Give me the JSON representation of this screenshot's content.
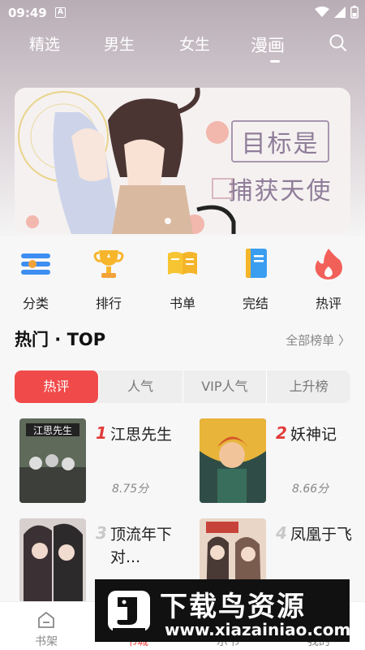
{
  "status_bar": {
    "time": "09:49",
    "notif_letter": "A"
  },
  "nav": {
    "tabs": [
      {
        "label": "精选",
        "active": false
      },
      {
        "label": "男生",
        "active": false
      },
      {
        "label": "女生",
        "active": false
      },
      {
        "label": "漫画",
        "active": true
      }
    ],
    "search_icon": "search-icon"
  },
  "banner": {
    "title_line1": "目标是",
    "title_line2": "捕获天使"
  },
  "categories": [
    {
      "label": "分类",
      "icon": "category-icon",
      "color": "#3d8ef0"
    },
    {
      "label": "排行",
      "icon": "trophy-icon",
      "color": "#f7b52c"
    },
    {
      "label": "书单",
      "icon": "book-icon",
      "color": "#f7c531"
    },
    {
      "label": "完结",
      "icon": "finished-book-icon",
      "color": "#3a9ef0"
    },
    {
      "label": "热评",
      "icon": "flame-icon",
      "color": "#f2605a"
    }
  ],
  "hot": {
    "title": "热门 · TOP",
    "more": "全部榜单 〉",
    "tabs": [
      {
        "label": "热评",
        "active": true
      },
      {
        "label": "人气",
        "active": false
      },
      {
        "label": "VIP人气",
        "active": false
      },
      {
        "label": "上升榜",
        "active": false
      }
    ],
    "items": [
      {
        "rank": "1",
        "name": "江思先生",
        "score": "8.75分"
      },
      {
        "rank": "2",
        "name": "妖神记",
        "score": "8.66分"
      },
      {
        "rank": "3",
        "name": "顶流年下对...",
        "score": ""
      },
      {
        "rank": "4",
        "name": "凤凰于飞",
        "score": ""
      }
    ]
  },
  "bottom_nav": [
    {
      "label": "书架",
      "icon": "bookshelf-icon",
      "active": false
    },
    {
      "label": "书城",
      "icon": "bookstore-icon",
      "active": true
    },
    {
      "label": "示书",
      "icon": "book-list-icon",
      "active": false
    },
    {
      "label": "我的",
      "icon": "profile-icon",
      "active": false
    }
  ],
  "watermark": {
    "title": "下载鸟资源",
    "url": "www.xiazainiao.com"
  },
  "colors": {
    "accent": "#f14a4a",
    "rank_top": "#e23b3b",
    "rank_rest": "#c9c9c9"
  }
}
